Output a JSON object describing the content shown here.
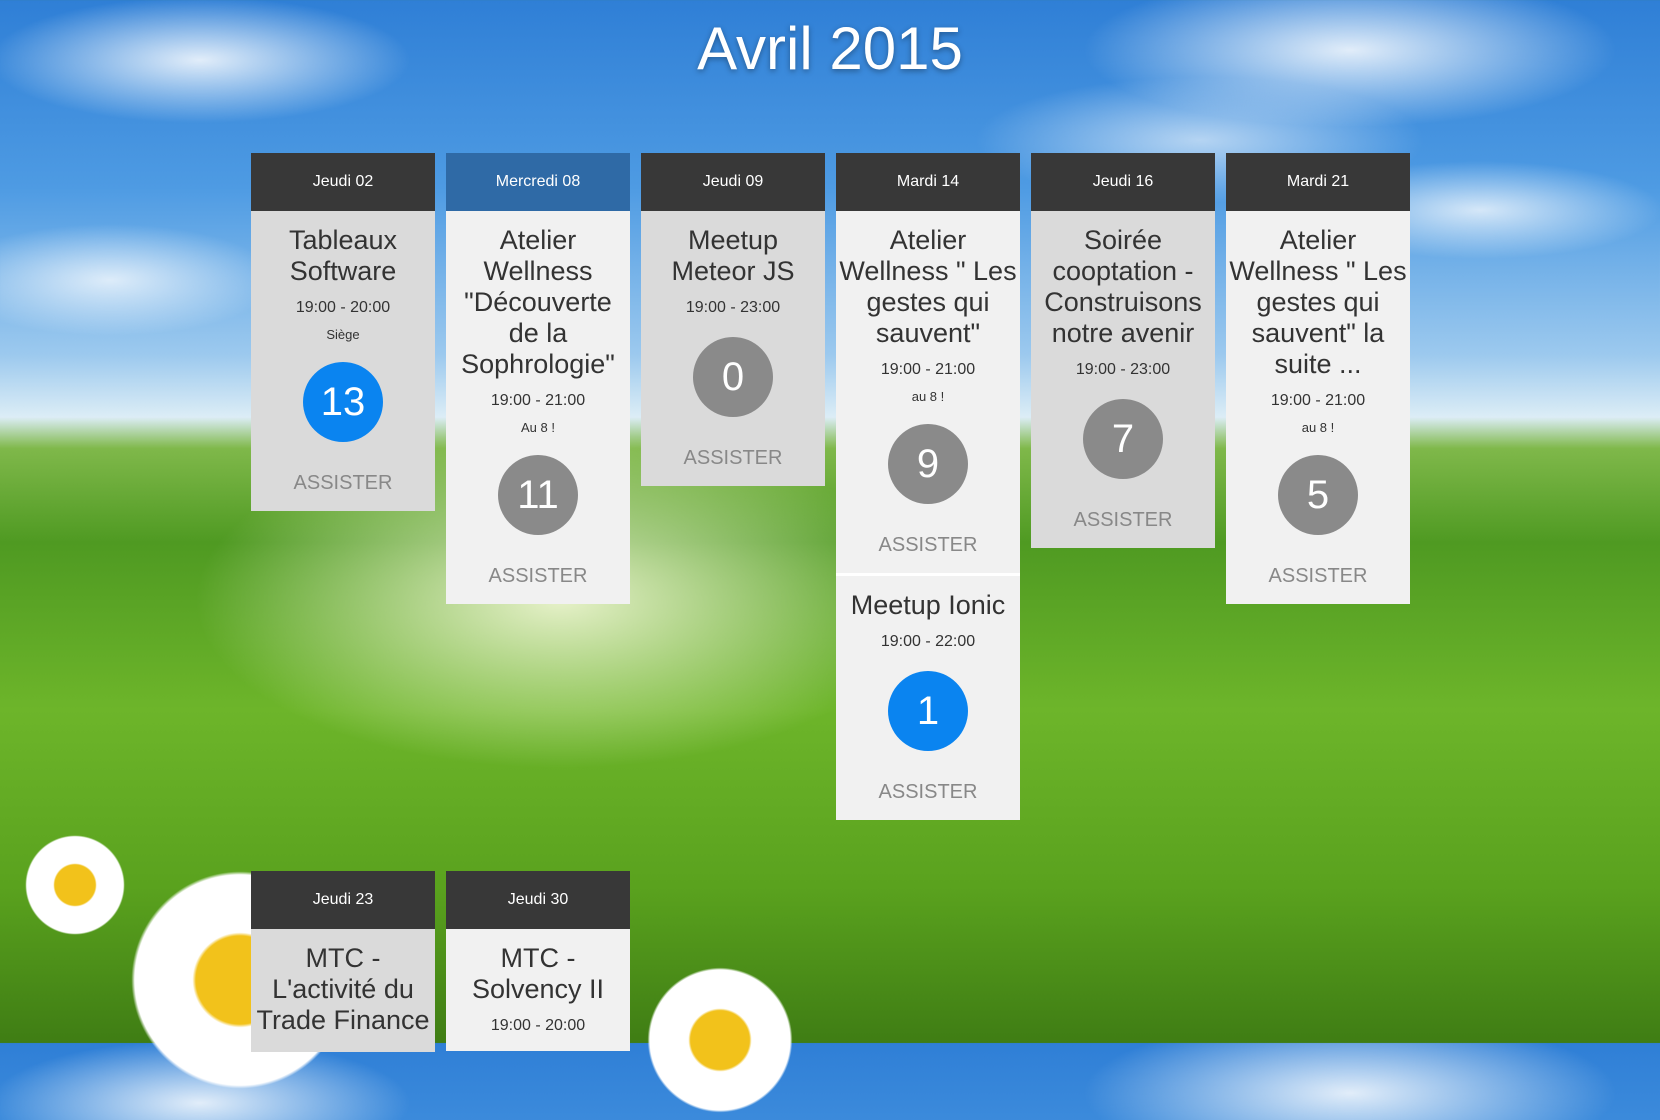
{
  "month_title": "Avril 2015",
  "days": [
    {
      "header": "Jeudi 02",
      "active": false,
      "events": [
        {
          "title": "Tableaux Software",
          "time": "19:00 - 20:00",
          "location": "Siège",
          "count": "13",
          "attending": true,
          "action": "ASSISTER"
        }
      ]
    },
    {
      "header": "Mercredi 08",
      "active": true,
      "events": [
        {
          "title": "Atelier Wellness \"Découverte de la Sophrologie\"",
          "time": "19:00 - 21:00",
          "location": "Au 8 !",
          "count": "11",
          "attending": false,
          "action": "ASSISTER"
        }
      ]
    },
    {
      "header": "Jeudi 09",
      "active": false,
      "events": [
        {
          "title": "Meetup Meteor JS",
          "time": "19:00 - 23:00",
          "location": "",
          "count": "0",
          "attending": false,
          "action": "ASSISTER"
        }
      ]
    },
    {
      "header": "Mardi 14",
      "active": false,
      "events": [
        {
          "title": "Atelier Wellness \" Les gestes qui sauvent\"",
          "time": "19:00 - 21:00",
          "location": "au 8 !",
          "count": "9",
          "attending": false,
          "action": "ASSISTER"
        },
        {
          "title": "Meetup Ionic",
          "time": "19:00 - 22:00",
          "location": "",
          "count": "1",
          "attending": true,
          "action": "ASSISTER"
        }
      ]
    },
    {
      "header": "Jeudi 16",
      "active": false,
      "events": [
        {
          "title": "Soirée cooptation - Construisons notre avenir",
          "time": "19:00 - 23:00",
          "location": "",
          "count": "7",
          "attending": false,
          "action": "ASSISTER"
        }
      ]
    },
    {
      "header": "Mardi 21",
      "active": false,
      "events": [
        {
          "title": "Atelier Wellness \" Les gestes qui sauvent\" la suite ...",
          "time": "19:00 - 21:00",
          "location": "au 8 !",
          "count": "5",
          "attending": false,
          "action": "ASSISTER"
        }
      ]
    },
    {
      "header": "Jeudi 23",
      "active": false,
      "events": [
        {
          "title": "MTC - L'activité du Trade Finance",
          "time": "",
          "location": "",
          "count": "",
          "attending": false,
          "action": ""
        }
      ]
    },
    {
      "header": "Jeudi 30",
      "active": false,
      "events": [
        {
          "title": "MTC - Solvency II",
          "time": "19:00 - 20:00",
          "location": "",
          "count": "",
          "attending": false,
          "action": ""
        }
      ]
    }
  ]
}
